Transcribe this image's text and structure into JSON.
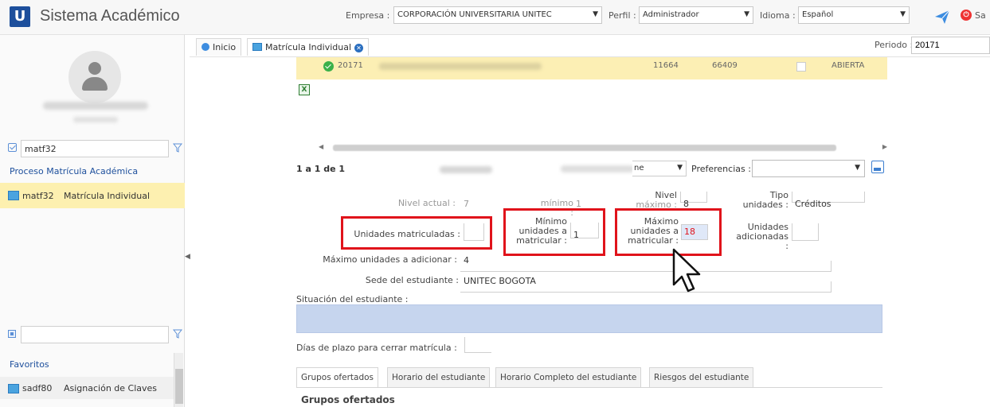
{
  "app": {
    "logo_letter": "U",
    "title": "Sistema Académico"
  },
  "header": {
    "empresa_label": "Empresa :",
    "empresa_value": "CORPORACIÓN UNIVERSITARIA UNITEC",
    "perfil_label": "Perfil :",
    "perfil_value": "Administrador",
    "idioma_label": "Idioma :",
    "idioma_value": "Español",
    "salir_label": "Sa"
  },
  "sidebar": {
    "search_value": "matf32",
    "process_title": "Proceso Matrícula Académica",
    "process_item": {
      "code": "matf32",
      "name": "Matrícula Individual"
    },
    "favorites_title": "Favoritos",
    "favorite_item": {
      "code": "sadf80",
      "name": "Asignación de Claves"
    }
  },
  "tabs": [
    {
      "label": "Inicio"
    },
    {
      "label": "Matrícula Individual"
    }
  ],
  "periodo": {
    "label": "Periodo :",
    "value": "20171"
  },
  "grid": {
    "row": {
      "period": "20171",
      "col_a": "11664",
      "col_b": "66409",
      "status": "ABIERTA"
    }
  },
  "pager": {
    "range": "1 a 1 de 1",
    "select_partial": "ne",
    "preferences_label": "Preferencias :"
  },
  "form": {
    "nivel_actual_label": "Nivel actual :",
    "nivel_actual_value": "7",
    "nivel_minimo_label": "mínimo :",
    "nivel_minimo_value": "1",
    "nivel_maximo_label_1": "Nivel",
    "nivel_maximo_label_2": "máximo :",
    "nivel_maximo_value": "8",
    "tipo_label_1": "Tipo",
    "tipo_label_2": "unidades :",
    "tipo_value": "Créditos",
    "unidades_matriculadas_label": "Unidades matriculadas :",
    "unidades_matriculadas_value": "",
    "minimo_label_1": "Mínimo",
    "minimo_label_2": "unidades a",
    "minimo_label_3": "matricular :",
    "minimo_value": "1",
    "maximo_label_1": "Máximo",
    "maximo_label_2": "unidades a",
    "maximo_label_3": "matricular :",
    "maximo_value": "18",
    "adicionadas_label_1": "Unidades",
    "adicionadas_label_2": "adicionadas :",
    "maximo_adicionar_label": "Máximo unidades a adicionar :",
    "maximo_adicionar_value": "4",
    "sede_label": "Sede del estudiante :",
    "sede_value": "UNITEC BOGOTA",
    "situacion_label": "Situación del estudiante :",
    "dias_label": "Días de plazo para cerrar matrícula :"
  },
  "bottom_tabs": [
    {
      "label": "Grupos ofertados"
    },
    {
      "label": "Horario del estudiante"
    },
    {
      "label": "Horario Completo del estudiante"
    },
    {
      "label": "Riesgos del estudiante"
    }
  ],
  "section_title": "Grupos ofertados",
  "colors": {
    "brand": "#1d4f9c",
    "highlight_row": "#fcefb4",
    "annotation_red": "#e0131b",
    "situacion_bg": "#c6d5ee",
    "max_value": "#e0131b"
  },
  "icons": [
    "unitec-logo-icon",
    "send-icon",
    "power-icon",
    "user-avatar-icon",
    "filter-icon",
    "checkbox-icon",
    "excel-icon",
    "save-icon",
    "close-icon",
    "cursor-icon"
  ]
}
